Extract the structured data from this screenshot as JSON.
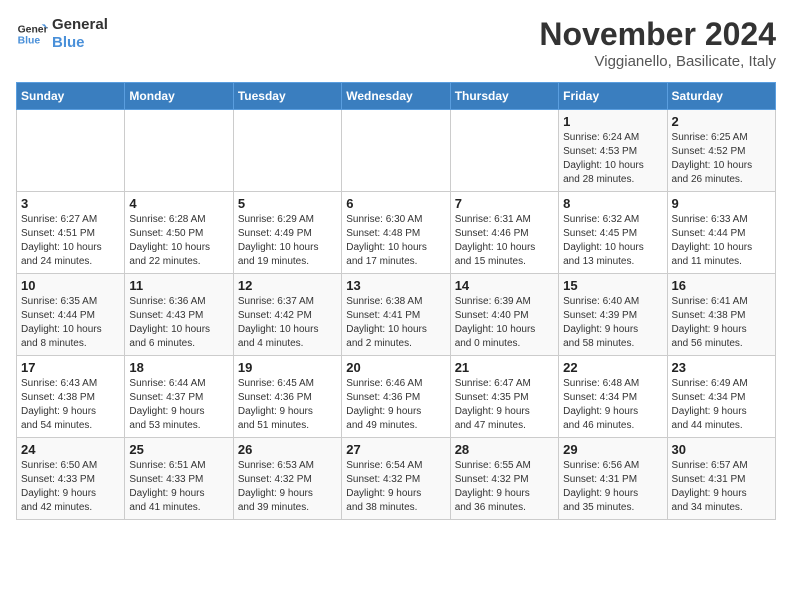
{
  "logo": {
    "line1": "General",
    "line2": "Blue"
  },
  "header": {
    "month": "November 2024",
    "location": "Viggianello, Basilicate, Italy"
  },
  "weekdays": [
    "Sunday",
    "Monday",
    "Tuesday",
    "Wednesday",
    "Thursday",
    "Friday",
    "Saturday"
  ],
  "weeks": [
    [
      {
        "day": "",
        "info": ""
      },
      {
        "day": "",
        "info": ""
      },
      {
        "day": "",
        "info": ""
      },
      {
        "day": "",
        "info": ""
      },
      {
        "day": "",
        "info": ""
      },
      {
        "day": "1",
        "info": "Sunrise: 6:24 AM\nSunset: 4:53 PM\nDaylight: 10 hours\nand 28 minutes."
      },
      {
        "day": "2",
        "info": "Sunrise: 6:25 AM\nSunset: 4:52 PM\nDaylight: 10 hours\nand 26 minutes."
      }
    ],
    [
      {
        "day": "3",
        "info": "Sunrise: 6:27 AM\nSunset: 4:51 PM\nDaylight: 10 hours\nand 24 minutes."
      },
      {
        "day": "4",
        "info": "Sunrise: 6:28 AM\nSunset: 4:50 PM\nDaylight: 10 hours\nand 22 minutes."
      },
      {
        "day": "5",
        "info": "Sunrise: 6:29 AM\nSunset: 4:49 PM\nDaylight: 10 hours\nand 19 minutes."
      },
      {
        "day": "6",
        "info": "Sunrise: 6:30 AM\nSunset: 4:48 PM\nDaylight: 10 hours\nand 17 minutes."
      },
      {
        "day": "7",
        "info": "Sunrise: 6:31 AM\nSunset: 4:46 PM\nDaylight: 10 hours\nand 15 minutes."
      },
      {
        "day": "8",
        "info": "Sunrise: 6:32 AM\nSunset: 4:45 PM\nDaylight: 10 hours\nand 13 minutes."
      },
      {
        "day": "9",
        "info": "Sunrise: 6:33 AM\nSunset: 4:44 PM\nDaylight: 10 hours\nand 11 minutes."
      }
    ],
    [
      {
        "day": "10",
        "info": "Sunrise: 6:35 AM\nSunset: 4:44 PM\nDaylight: 10 hours\nand 8 minutes."
      },
      {
        "day": "11",
        "info": "Sunrise: 6:36 AM\nSunset: 4:43 PM\nDaylight: 10 hours\nand 6 minutes."
      },
      {
        "day": "12",
        "info": "Sunrise: 6:37 AM\nSunset: 4:42 PM\nDaylight: 10 hours\nand 4 minutes."
      },
      {
        "day": "13",
        "info": "Sunrise: 6:38 AM\nSunset: 4:41 PM\nDaylight: 10 hours\nand 2 minutes."
      },
      {
        "day": "14",
        "info": "Sunrise: 6:39 AM\nSunset: 4:40 PM\nDaylight: 10 hours\nand 0 minutes."
      },
      {
        "day": "15",
        "info": "Sunrise: 6:40 AM\nSunset: 4:39 PM\nDaylight: 9 hours\nand 58 minutes."
      },
      {
        "day": "16",
        "info": "Sunrise: 6:41 AM\nSunset: 4:38 PM\nDaylight: 9 hours\nand 56 minutes."
      }
    ],
    [
      {
        "day": "17",
        "info": "Sunrise: 6:43 AM\nSunset: 4:38 PM\nDaylight: 9 hours\nand 54 minutes."
      },
      {
        "day": "18",
        "info": "Sunrise: 6:44 AM\nSunset: 4:37 PM\nDaylight: 9 hours\nand 53 minutes."
      },
      {
        "day": "19",
        "info": "Sunrise: 6:45 AM\nSunset: 4:36 PM\nDaylight: 9 hours\nand 51 minutes."
      },
      {
        "day": "20",
        "info": "Sunrise: 6:46 AM\nSunset: 4:36 PM\nDaylight: 9 hours\nand 49 minutes."
      },
      {
        "day": "21",
        "info": "Sunrise: 6:47 AM\nSunset: 4:35 PM\nDaylight: 9 hours\nand 47 minutes."
      },
      {
        "day": "22",
        "info": "Sunrise: 6:48 AM\nSunset: 4:34 PM\nDaylight: 9 hours\nand 46 minutes."
      },
      {
        "day": "23",
        "info": "Sunrise: 6:49 AM\nSunset: 4:34 PM\nDaylight: 9 hours\nand 44 minutes."
      }
    ],
    [
      {
        "day": "24",
        "info": "Sunrise: 6:50 AM\nSunset: 4:33 PM\nDaylight: 9 hours\nand 42 minutes."
      },
      {
        "day": "25",
        "info": "Sunrise: 6:51 AM\nSunset: 4:33 PM\nDaylight: 9 hours\nand 41 minutes."
      },
      {
        "day": "26",
        "info": "Sunrise: 6:53 AM\nSunset: 4:32 PM\nDaylight: 9 hours\nand 39 minutes."
      },
      {
        "day": "27",
        "info": "Sunrise: 6:54 AM\nSunset: 4:32 PM\nDaylight: 9 hours\nand 38 minutes."
      },
      {
        "day": "28",
        "info": "Sunrise: 6:55 AM\nSunset: 4:32 PM\nDaylight: 9 hours\nand 36 minutes."
      },
      {
        "day": "29",
        "info": "Sunrise: 6:56 AM\nSunset: 4:31 PM\nDaylight: 9 hours\nand 35 minutes."
      },
      {
        "day": "30",
        "info": "Sunrise: 6:57 AM\nSunset: 4:31 PM\nDaylight: 9 hours\nand 34 minutes."
      }
    ]
  ]
}
